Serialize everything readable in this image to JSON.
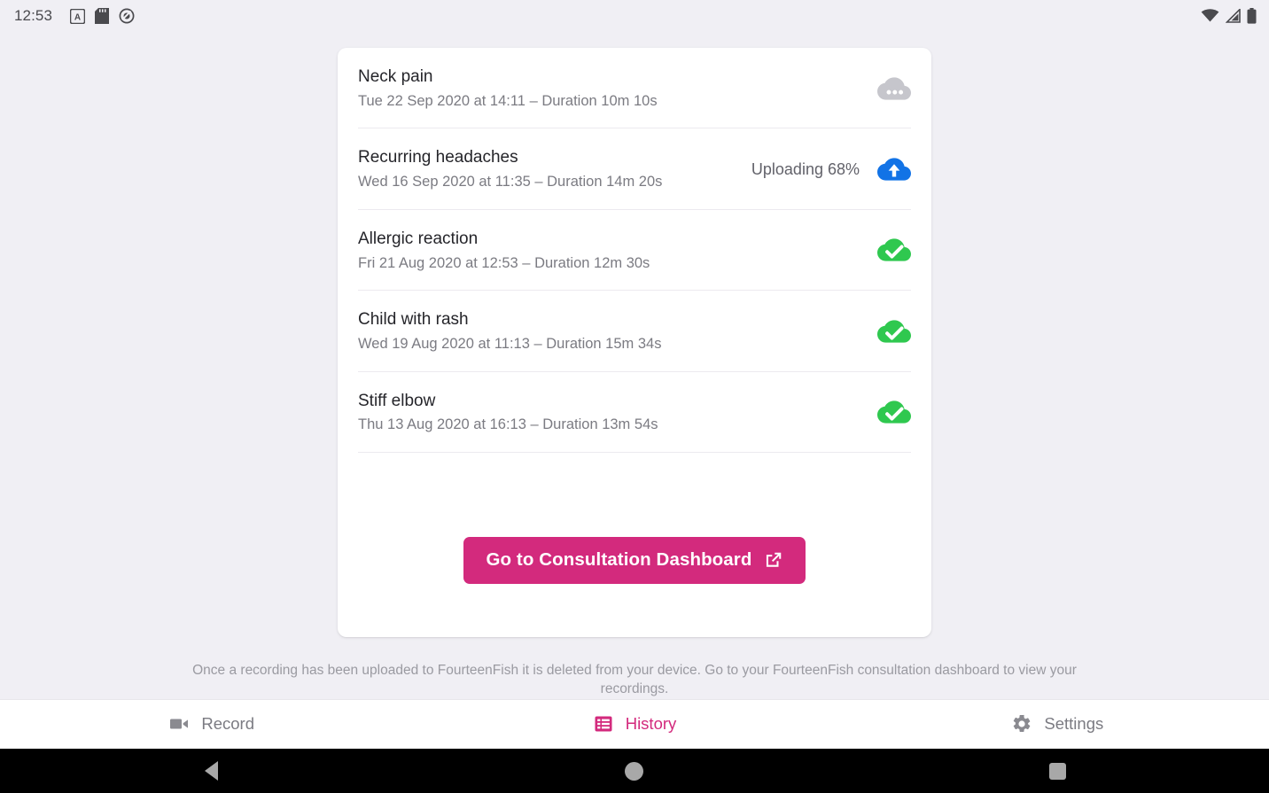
{
  "status_bar": {
    "clock": "12:53",
    "left_icons": [
      "a-badge-icon",
      "sd-card-icon",
      "do-not-disturb-icon"
    ],
    "right_icons": [
      "wifi-icon",
      "cell-signal-icon",
      "battery-icon"
    ]
  },
  "recordings": [
    {
      "title": "Neck pain",
      "subtitle": "Tue 22 Sep 2020 at 14:11 – Duration 10m 10s",
      "status_text": "",
      "status_icon": "cloud-pending-icon",
      "status_color": "#c6c6cc"
    },
    {
      "title": "Recurring headaches",
      "subtitle": "Wed 16 Sep 2020 at 11:35 – Duration 14m 20s",
      "status_text": "Uploading 68%",
      "status_icon": "cloud-upload-icon",
      "status_color": "#1273e6"
    },
    {
      "title": "Allergic reaction",
      "subtitle": "Fri 21 Aug 2020 at 12:53 – Duration 12m 30s",
      "status_text": "",
      "status_icon": "cloud-done-icon",
      "status_color": "#2fc84f"
    },
    {
      "title": "Child with rash",
      "subtitle": "Wed 19 Aug 2020 at 11:13 – Duration 15m 34s",
      "status_text": "",
      "status_icon": "cloud-done-icon",
      "status_color": "#2fc84f"
    },
    {
      "title": "Stiff elbow",
      "subtitle": "Thu 13 Aug 2020 at 16:13 – Duration 13m 54s",
      "status_text": "",
      "status_icon": "cloud-done-icon",
      "status_color": "#2fc84f"
    }
  ],
  "cta": {
    "label": "Go to Consultation Dashboard",
    "icon": "external-link-icon",
    "color": "#d32a7d"
  },
  "footer_note": "Once a recording has been uploaded to FourteenFish it is deleted from your device. Go to your FourteenFish consultation dashboard to view your recordings.",
  "tabs": [
    {
      "label": "Record",
      "icon": "video-camera-icon",
      "active": false
    },
    {
      "label": "History",
      "icon": "list-icon",
      "active": true
    },
    {
      "label": "Settings",
      "icon": "gear-icon",
      "active": false
    }
  ],
  "android_nav": {
    "back": "back-triangle-icon",
    "home": "home-circle-icon",
    "recents": "recents-square-icon"
  }
}
